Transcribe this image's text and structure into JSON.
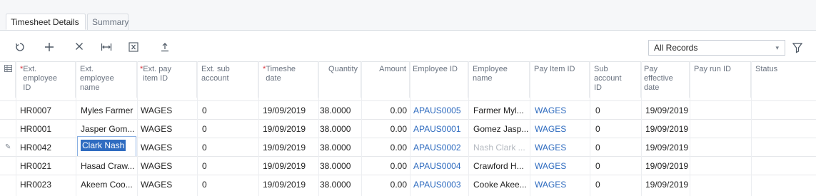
{
  "tabs": [
    {
      "label": "Timesheet Details"
    },
    {
      "label": "Summary"
    }
  ],
  "toolbar": {
    "icons": [
      "refresh-icon",
      "add-icon",
      "delete-icon",
      "fit-columns-icon",
      "export-excel-icon",
      "upload-icon"
    ]
  },
  "filter": {
    "selected": "All Records"
  },
  "columns": {
    "ext_emp_id": {
      "req": "*",
      "label": "Ext. employee ID"
    },
    "ext_emp_name": {
      "req": "",
      "label": "Ext. employee name"
    },
    "ext_pay_item": {
      "req": "*",
      "label": "Ext. pay item ID"
    },
    "ext_sub": {
      "req": "",
      "label": "Ext. sub account"
    },
    "timesheet_date": {
      "req": "*",
      "label": "Timeshe date"
    },
    "quantity": {
      "req": "",
      "label": "Quantity"
    },
    "amount": {
      "req": "",
      "label": "Amount"
    },
    "employee_id": {
      "req": "",
      "label": "Employee ID"
    },
    "employee_name": {
      "req": "",
      "label": "Employee name"
    },
    "pay_item_id": {
      "req": "",
      "label": "Pay Item ID"
    },
    "sub_account": {
      "req": "",
      "label": "Sub account ID"
    },
    "pay_effective": {
      "req": "",
      "label": "Pay effective date"
    },
    "pay_run": {
      "req": "",
      "label": "Pay run ID"
    },
    "status": {
      "req": "",
      "label": "Status"
    }
  },
  "rows": [
    {
      "ext_id": "HR0007",
      "name": "Myles Farmer",
      "pay_item": "WAGES",
      "sub": "0",
      "date": "19/09/2019",
      "qty": "38.0000",
      "amount": "0.00",
      "emp_id": "APAUS0005",
      "emp_name": "Farmer Myl...",
      "pay_item_id": "WAGES",
      "sub_id": "0",
      "eff_date": "19/09/2019",
      "pay_run": "",
      "status": ""
    },
    {
      "ext_id": "HR0001",
      "name": "Jasper Gom...",
      "pay_item": "WAGES",
      "sub": "0",
      "date": "19/09/2019",
      "qty": "38.0000",
      "amount": "0.00",
      "emp_id": "APAUS0001",
      "emp_name": "Gomez Jasp...",
      "pay_item_id": "WAGES",
      "sub_id": "0",
      "eff_date": "19/09/2019",
      "pay_run": "",
      "status": ""
    },
    {
      "ext_id": "HR0042",
      "name": "Clark Nash",
      "pay_item": "WAGES",
      "sub": "0",
      "date": "19/09/2019",
      "qty": "38.0000",
      "amount": "0.00",
      "emp_id": "APAUS0002",
      "emp_name": "Nash Clark ...",
      "pay_item_id": "WAGES",
      "sub_id": "0",
      "eff_date": "19/09/2019",
      "pay_run": "",
      "status": ""
    },
    {
      "ext_id": "HR0021",
      "name": "Hasad Craw...",
      "pay_item": "WAGES",
      "sub": "0",
      "date": "19/09/2019",
      "qty": "38.0000",
      "amount": "0.00",
      "emp_id": "APAUS0004",
      "emp_name": "Crawford H...",
      "pay_item_id": "WAGES",
      "sub_id": "0",
      "eff_date": "19/09/2019",
      "pay_run": "",
      "status": ""
    },
    {
      "ext_id": "HR0023",
      "name": "Akeem Coo...",
      "pay_item": "WAGES",
      "sub": "0",
      "date": "19/09/2019",
      "qty": "38.0000",
      "amount": "0.00",
      "emp_id": "APAUS0003",
      "emp_name": "Cooke Akee...",
      "pay_item_id": "WAGES",
      "sub_id": "0",
      "eff_date": "19/09/2019",
      "pay_run": "",
      "status": ""
    }
  ],
  "colors": {
    "link": "#2e6bbf",
    "selection": "#2f6cc1",
    "required": "#d9363e"
  }
}
